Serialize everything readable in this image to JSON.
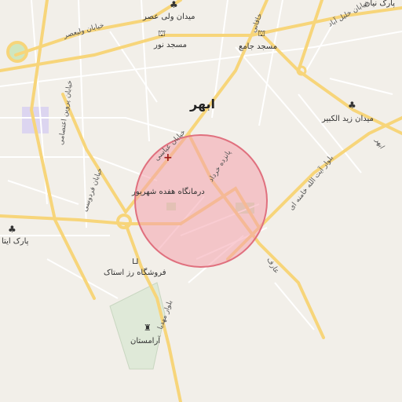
{
  "city_label": "ابهر",
  "places": {
    "meydan_vali_asr": "میدان ولی عصر",
    "masjed_nour": "مسجد نور",
    "masjed_jame": "مسجد جامع",
    "park_hanir": "پارک نیان",
    "meydan_zeyd": "میدان زید الکبیر",
    "clinic": "درمانگاه هفده شهریور",
    "park_ita": "پارک ایتا",
    "store": "فروشگاه رز استاک",
    "cemetery": "آرامستان"
  },
  "roads": {
    "khiaban_valiasr": "خیابان ولیعصر",
    "khiaban_mohammad": "خیابان محمد",
    "khiaban_khalil_abad": "خیابان خلیل آباد",
    "khaqani": "خاقانی",
    "khiaban_abbasi": "خیابان عباسی",
    "khiaban_khordad": "پانزده خرداد",
    "khiaban_ferdowsi": "خیابان فردوسی",
    "khiaban_parvin": "خیابان پروین اعتصامی",
    "blvd_khamenei": "بلوار آیت الله خامنه ای",
    "blvd_mahdi": "بلوار مهدیا",
    "aref": "عارف",
    "abhar_road": "ابهر"
  },
  "colors": {
    "background": "#f2efe9",
    "major_road": "#f7d57a",
    "minor_road": "#ffffff",
    "circle_fill": "#f4a3ad",
    "circle_stroke": "#e0707e",
    "park": "#cfe6bf",
    "water": "#dcd5f0"
  },
  "icons": [
    "tree-icon",
    "mosque-icon",
    "hospital-cross-icon",
    "shopping-cart-icon",
    "cemetery-icon",
    "roundabout-icon"
  ]
}
